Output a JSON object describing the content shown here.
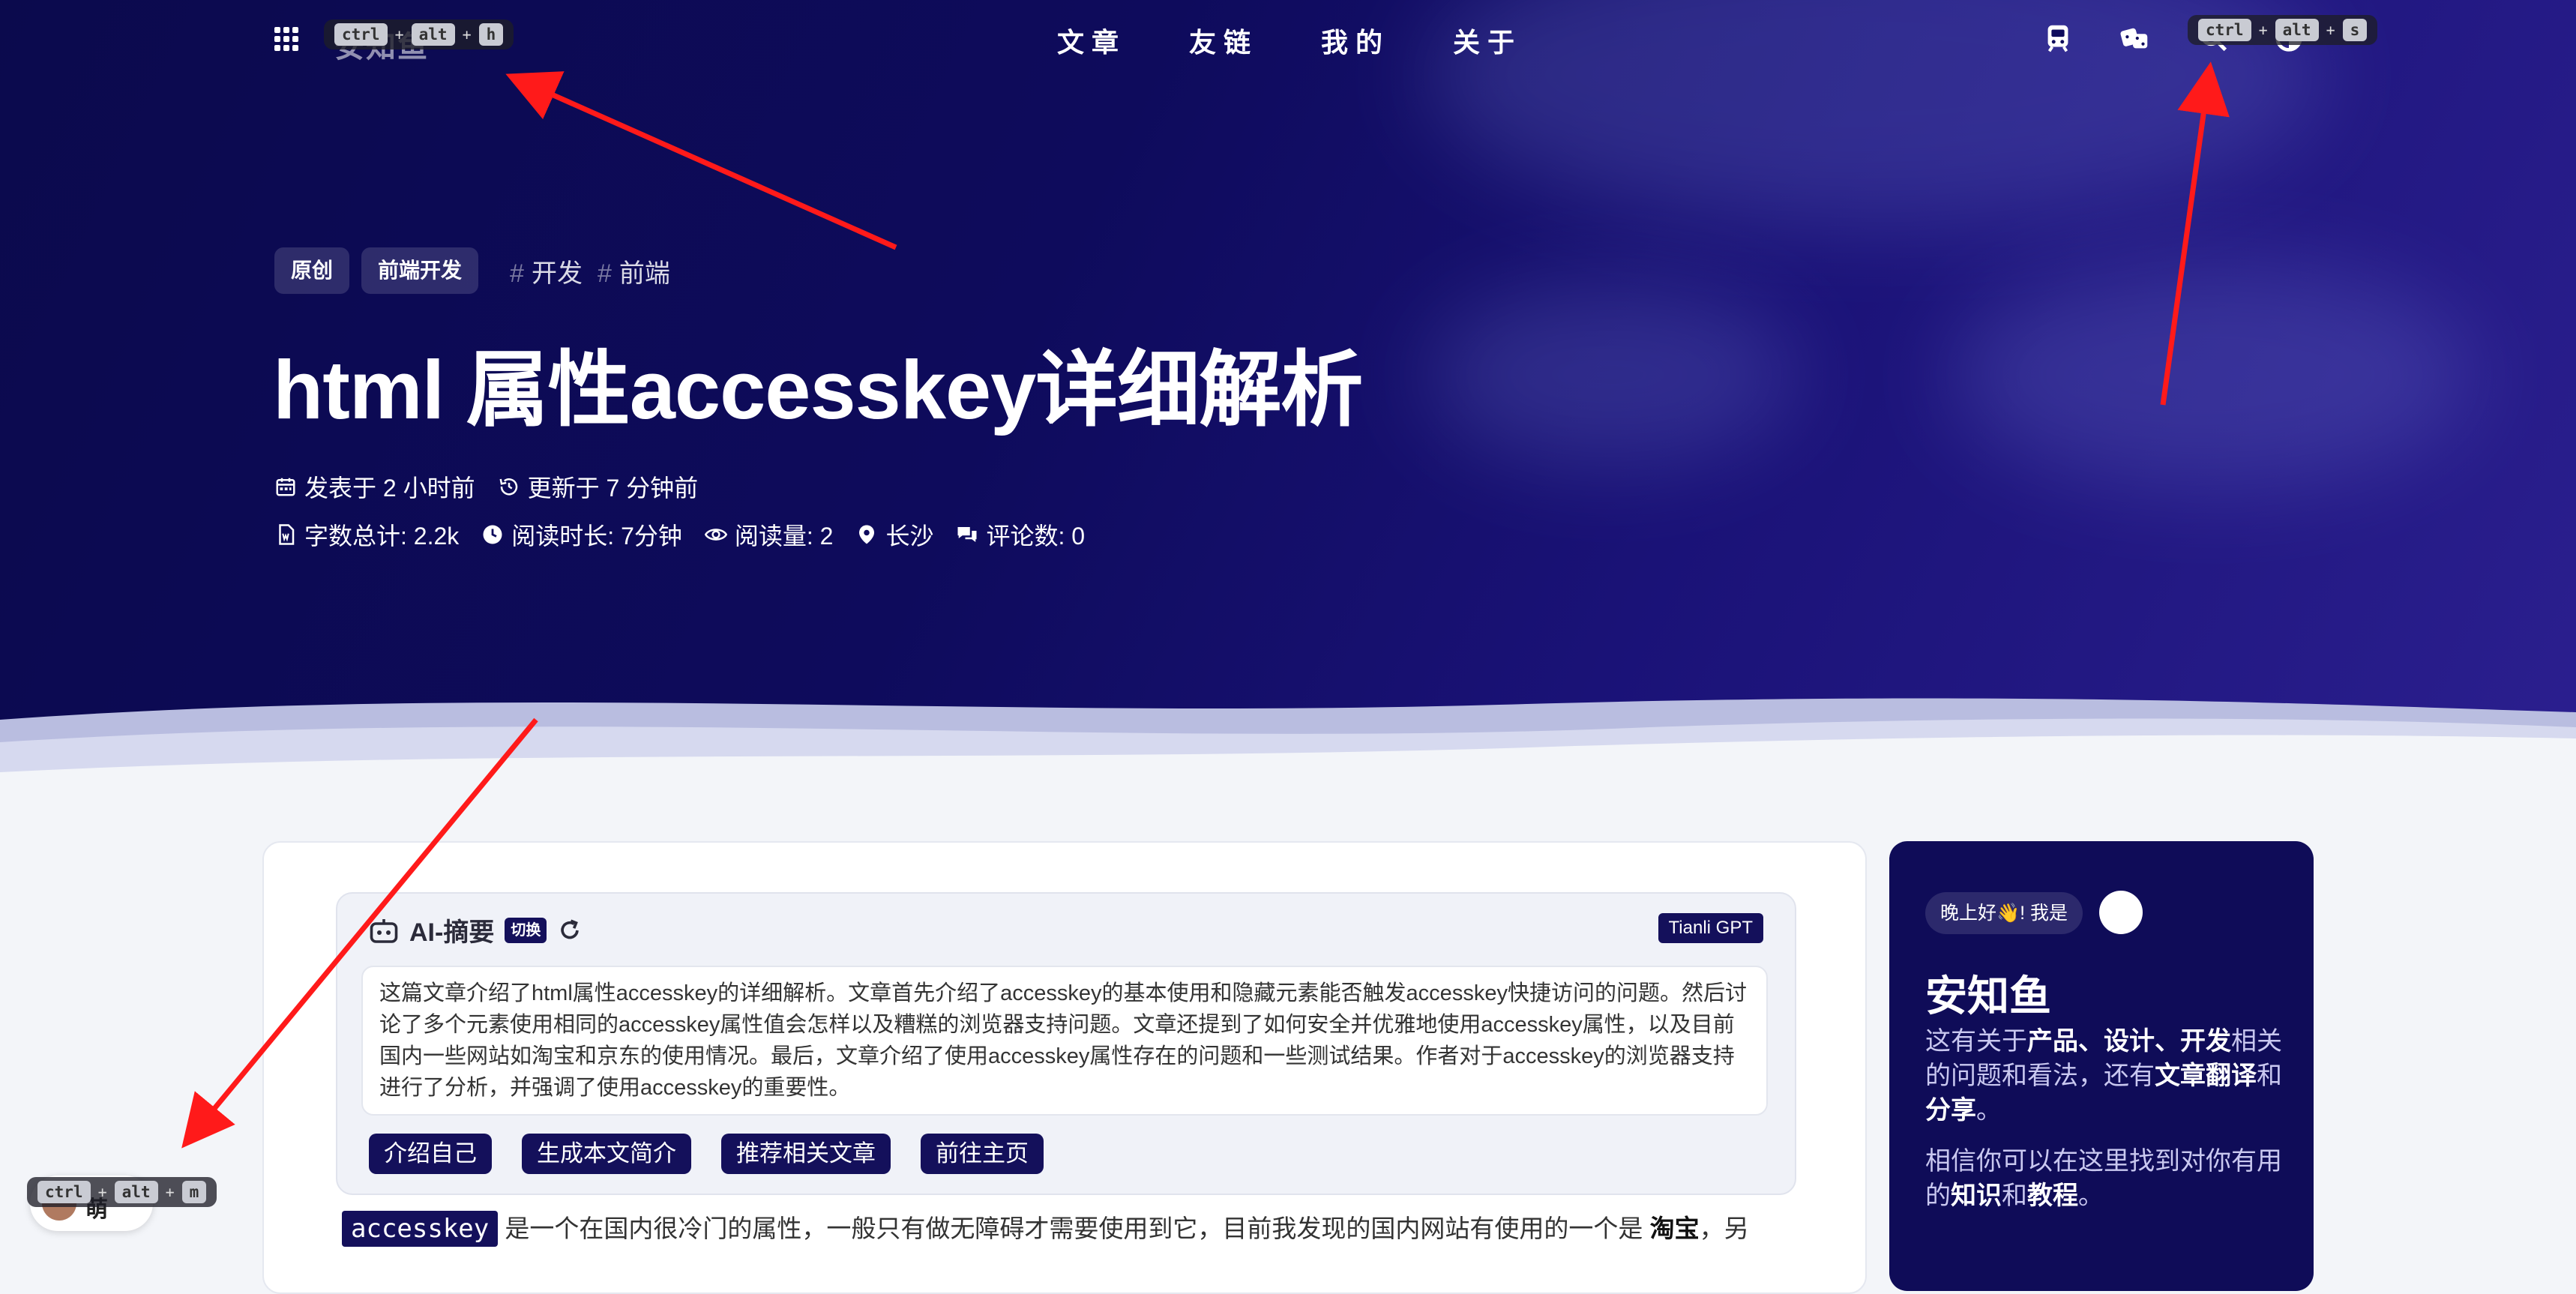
{
  "nav": {
    "brand": "安知鱼",
    "menu": [
      "文章",
      "友链",
      "我的",
      "关于"
    ],
    "shortcut_home": [
      "ctrl",
      "alt",
      "h"
    ],
    "shortcut_search": [
      "ctrl",
      "alt",
      "s"
    ],
    "shortcut_music": [
      "ctrl",
      "alt",
      "m"
    ],
    "icons": [
      "apps-grid-icon",
      "subway-icon",
      "dice-icon",
      "search-icon",
      "theme-icon"
    ]
  },
  "post": {
    "tags": [
      "原创",
      "前端开发"
    ],
    "hashtags": [
      "开发",
      "前端"
    ],
    "title": "html 属性accesskey详细解析",
    "meta_line1": [
      "发表于 2 小时前",
      "更新于 7 分钟前"
    ],
    "meta_line2": [
      "字数总计: 2.2k",
      "阅读时长: 7分钟",
      "阅读量: 2",
      "长沙",
      "评论数: 0"
    ]
  },
  "ai": {
    "title": "AI-摘要",
    "switch": "切换",
    "badge": "Tianli GPT",
    "summary": "这篇文章介绍了html属性accesskey的详细解析。文章首先介绍了accesskey的基本使用和隐藏元素能否触发accesskey快捷访问的问题。然后讨论了多个元素使用相同的accesskey属性值会怎样以及糟糕的浏览器支持问题。文章还提到了如何安全并优雅地使用accesskey属性，以及目前国内一些网站如淘宝和京东的使用情况。最后，文章介绍了使用accesskey属性存在的问题和一些测试结果。作者对于accesskey的浏览器支持进行了分析，并强调了使用accesskey的重要性。",
    "actions": [
      "介绍自己",
      "生成本文简介",
      "推荐相关文章",
      "前往主页"
    ]
  },
  "article": {
    "code": "accesskey",
    "text_a": " 是一个在国内很冷门的属性，一般只有做无障碍才需要使用到它，目前我发现的国内网站有使用的一个是 ",
    "bold": "淘宝",
    "text_b": "，另"
  },
  "sidebar": {
    "greeting": "晚上好👋! 我是",
    "name": "安知鱼",
    "p1_a": "这有关于",
    "p1_b1": "产品、设计、开发",
    "p1_c": "相关的问题和看法，还有",
    "p1_b2": "文章翻译",
    "p1_d": "和",
    "p1_b3": "分享",
    "p1_e": "。",
    "p2_a": "相信你可以在这里找到对你有用的",
    "p2_b1": "知识",
    "p2_c": "和",
    "p2_b2": "教程",
    "p2_d": "。"
  },
  "music": {
    "label": "萌"
  },
  "colors": {
    "accent": "#14105b",
    "hero": "#0e0b5c",
    "arrow": "#ff1a1a"
  }
}
